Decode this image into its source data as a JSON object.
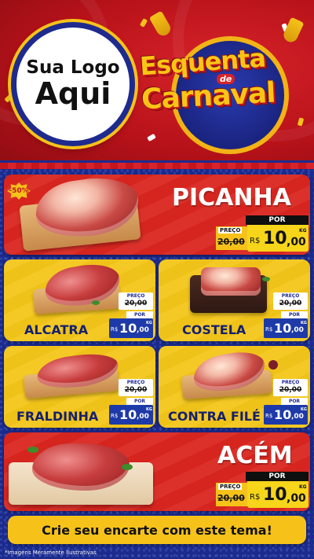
{
  "header": {
    "logo_line1": "Sua Logo",
    "logo_line2": "Aqui",
    "title_line1": "Esquenta",
    "title_connector": "de",
    "title_line2": "Carnaval"
  },
  "labels": {
    "old_price": "PREÇO",
    "new_price": "POR",
    "currency": "R$",
    "unit": "KG"
  },
  "products": [
    {
      "name": "PICANHA",
      "badge": "-50%",
      "old_price": "20,00",
      "price_int": "10",
      "price_cents": ",00"
    },
    {
      "name": "ALCATRA",
      "old_price": "20,00",
      "price_int": "10",
      "price_cents": ",00"
    },
    {
      "name": "COSTELA",
      "old_price": "20,00",
      "price_int": "10",
      "price_cents": ",00"
    },
    {
      "name": "FRALDINHA",
      "old_price": "20,00",
      "price_int": "10",
      "price_cents": ",00"
    },
    {
      "name": "CONTRA FILÉ",
      "old_price": "20,00",
      "price_int": "10",
      "price_cents": ",00"
    },
    {
      "name": "ACÉM",
      "old_price": "20,00",
      "price_int": "10",
      "price_cents": ",00"
    }
  ],
  "footer": {
    "cta": "Crie seu encarte com este tema!",
    "disclaimer": "*Imagens Meramente Ilustrativas"
  },
  "colors": {
    "red": "#d9261f",
    "yellow": "#f4c619",
    "navy": "#1e2a8e",
    "price_blue": "#1e3aa8"
  }
}
